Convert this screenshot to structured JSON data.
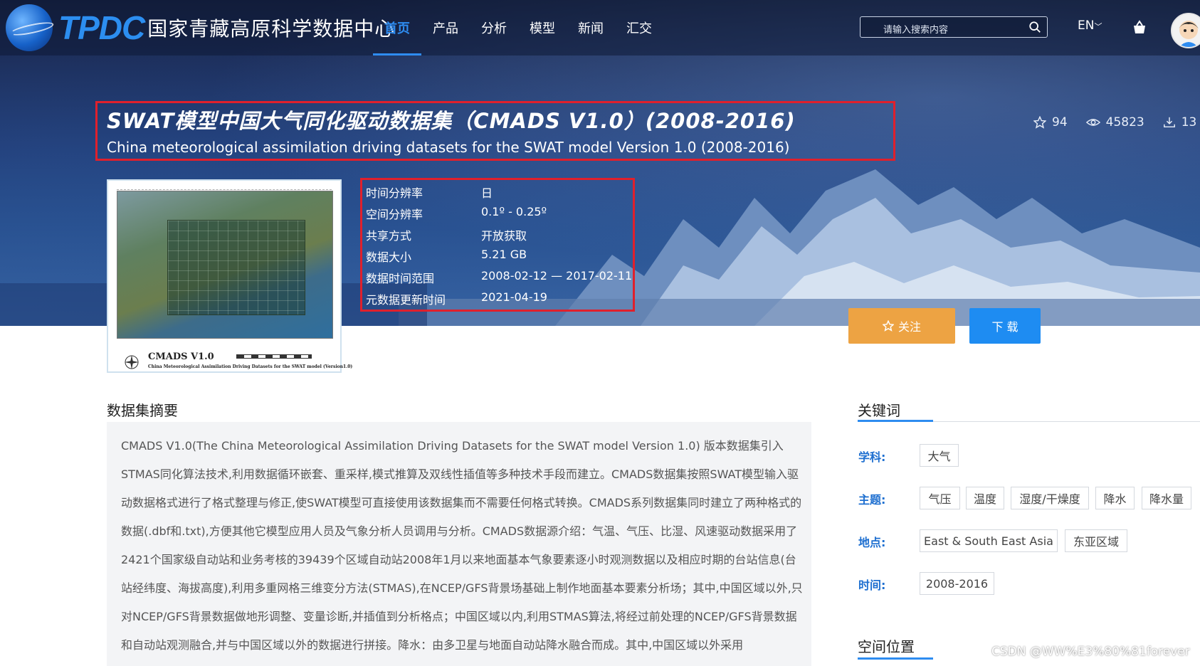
{
  "header": {
    "logo_abbr": "TPDC",
    "logo_name": "国家青藏高原科学数据中心",
    "menu": [
      {
        "label": "首页",
        "active": true
      },
      {
        "label": "产品",
        "active": false
      },
      {
        "label": "分析",
        "active": false
      },
      {
        "label": "模型",
        "active": false
      },
      {
        "label": "新闻",
        "active": false
      },
      {
        "label": "汇交",
        "active": false
      }
    ],
    "search_placeholder": "请输入搜索内容",
    "language": "EN"
  },
  "dataset": {
    "title_cn": "SWAT模型中国大气同化驱动数据集（CMADS V1.0）(2008-2016)",
    "title_en": "China meteorological assimilation driving datasets for the SWAT model Version 1.0 (2008-2016)",
    "stats": {
      "favorites": "94",
      "views": "45823",
      "downloads": "13"
    },
    "thumbnail": {
      "caption": "CMADS V1.0",
      "subcaption": "China Meteorological Assimilation Driving Datasets for the SWAT model (Version1.0)"
    },
    "info": [
      {
        "key": "时间分辨率",
        "value": "日"
      },
      {
        "key": "空间分辨率",
        "value": "0.1º - 0.25º"
      },
      {
        "key": "共享方式",
        "value": "开放获取"
      },
      {
        "key": "数据大小",
        "value": "5.21 GB"
      },
      {
        "key": "数据时间范围",
        "value": "2008-02-12 — 2017-02-11"
      },
      {
        "key": "元数据更新时间",
        "value": "2021-04-19"
      }
    ],
    "follow_label": "关注",
    "download_label": "下 载"
  },
  "abstract": {
    "heading": "数据集摘要",
    "text": "CMADS V1.0(The China Meteorological Assimilation Driving Datasets for the SWAT model Version 1.0) 版本数据集引入STMAS同化算法技术,利用数据循环嵌套、重采样,模式推算及双线性插值等多种技术手段而建立。CMADS数据集按照SWAT模型输入驱动数据格式进行了格式整理与修正,使SWAT模型可直接使用该数据集而不需要任何格式转换。CMADS系列数据集同时建立了两种格式的数据(.dbf和.txt),方便其他它模型应用人员及气象分析人员调用与分析。CMADS数据源介绍：气温、气压、比湿、风速驱动数据采用了2421个国家级自动站和业务考核的39439个区域自动站2008年1月以来地面基本气象要素逐小时观测数据以及相应时期的台站信息(台站经纬度、海拔高度),利用多重网格三维变分方法(STMAS),在NCEP/GFS背景场基础上制作地面基本要素分析场；其中,中国区域以外,只对NCEP/GFS背景数据做地形调整、变量诊断,并插值到分析格点；中国区域以内,利用STMAS算法,将经过前处理的NCEP/GFS背景数据和自动站观测融合,并与中国区域以外的数据进行拼接。降水：由多卫星与地面自动站降水融合而成。其中,中国区域以外采用"
  },
  "keywords": {
    "heading": "关键词",
    "groups": [
      {
        "label": "学科:",
        "tags": [
          "大气"
        ]
      },
      {
        "label": "主题:",
        "tags": [
          "气压",
          "温度",
          "湿度/干燥度",
          "降水",
          "降水量"
        ]
      },
      {
        "label": "地点:",
        "tags": [
          "East & South East Asia",
          "东亚区域"
        ]
      },
      {
        "label": "时间:",
        "tags": [
          "2008-2016"
        ]
      }
    ]
  },
  "spatial_heading": "空间位置",
  "watermark": "CSDN @WW%E3%80%81forever",
  "colors": {
    "accent": "#2e8cf0",
    "follow": "#eda343",
    "download": "#1e8cf2",
    "highlight": "#e0202c"
  }
}
